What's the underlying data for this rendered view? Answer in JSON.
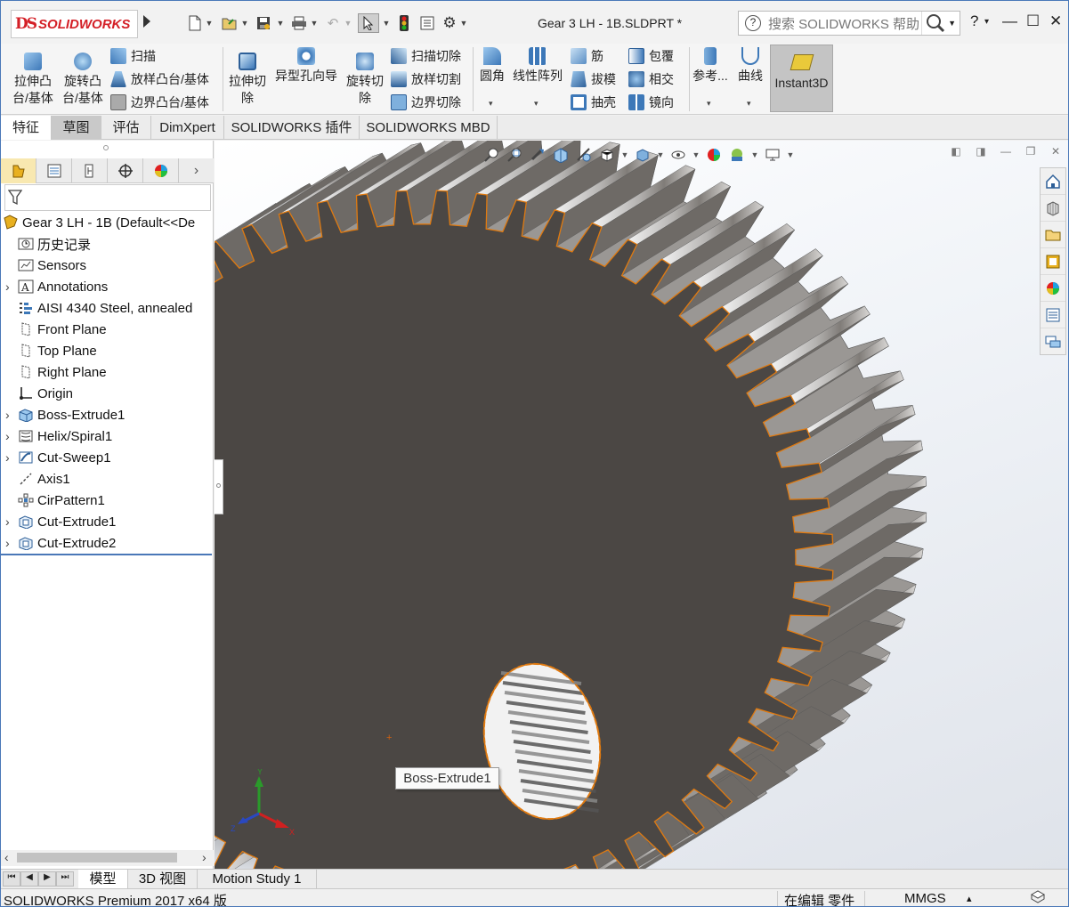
{
  "app": {
    "brand_mark": "DS",
    "brand_name": "SOLIDWORKS",
    "window_title": "Gear 3 LH - 1B.SLDPRT *"
  },
  "search": {
    "placeholder": "搜索 SOLIDWORKS 帮助",
    "help_char": "?"
  },
  "window_controls": {
    "help": "?",
    "help_dd": "▾",
    "minimize": "—",
    "maximize": "☐",
    "close": "✕"
  },
  "commands": {
    "extrude_boss": [
      "拉伸凸",
      "台/基体"
    ],
    "revolve_boss": [
      "旋转凸",
      "台/基体"
    ],
    "sweep": "扫描",
    "loft": "放样凸台/基体",
    "boundary": "边界凸台/基体",
    "extrude_cut": [
      "拉伸切",
      "除"
    ],
    "hole_wizard": "异型孔向导",
    "revolve_cut": [
      "旋转切",
      "除"
    ],
    "swept_cut": "扫描切除",
    "lofted_cut": "放样切割",
    "boundary_cut": "边界切除",
    "fillet": "圆角",
    "linear_pattern": "线性阵列",
    "rib": "筋",
    "draft": "拔模",
    "shell": "抽壳",
    "wrap": "包覆",
    "intersect": "相交",
    "mirror": "镜向",
    "reference": "参考...",
    "curves": "曲线",
    "instant3d": "Instant3D",
    "dd": "▾"
  },
  "tabs": [
    "特征",
    "草图",
    "评估",
    "DimXpert",
    "SOLIDWORKS 插件",
    "SOLIDWORKS MBD"
  ],
  "tree": {
    "root": "Gear 3 LH - 1B  (Default<<De",
    "items": [
      {
        "label": "历史记录",
        "icon": "history-icon",
        "expandable": false
      },
      {
        "label": "Sensors",
        "icon": "sensors-icon",
        "expandable": false
      },
      {
        "label": "Annotations",
        "icon": "annotations-icon",
        "expandable": true
      },
      {
        "label": "AISI 4340 Steel, annealed",
        "icon": "material-icon",
        "expandable": false
      },
      {
        "label": "Front Plane",
        "icon": "plane-icon",
        "expandable": false
      },
      {
        "label": "Top Plane",
        "icon": "plane-icon",
        "expandable": false
      },
      {
        "label": "Right Plane",
        "icon": "plane-icon",
        "expandable": false
      },
      {
        "label": "Origin",
        "icon": "origin-icon",
        "expandable": false
      },
      {
        "label": "Boss-Extrude1",
        "icon": "extrude-icon",
        "expandable": true
      },
      {
        "label": "Helix/Spiral1",
        "icon": "helix-icon",
        "expandable": true
      },
      {
        "label": "Cut-Sweep1",
        "icon": "cut-sweep-icon",
        "expandable": true
      },
      {
        "label": "Axis1",
        "icon": "axis-icon",
        "expandable": false
      },
      {
        "label": "CirPattern1",
        "icon": "cirpattern-icon",
        "expandable": false
      },
      {
        "label": "Cut-Extrude1",
        "icon": "cut-extrude-icon",
        "expandable": true
      },
      {
        "label": "Cut-Extrude2",
        "icon": "cut-extrude-icon",
        "expandable": true
      }
    ]
  },
  "viewport": {
    "tooltip": "Boss-Extrude1",
    "triad": {
      "x": "X",
      "y": "Y",
      "z": "Z"
    },
    "origin_symbol": "+"
  },
  "bottom_tabs": [
    "模型",
    "3D 视图",
    "Motion Study 1"
  ],
  "status": {
    "product": "SOLIDWORKS Premium 2017 x64 版",
    "mode": "在编辑 零件",
    "units": "MMGS",
    "units_dd": "▴"
  },
  "colors": {
    "accent": "#4a78b8",
    "brand": "#d42027",
    "gear_face": "#4b4744",
    "edge": "#e07a10"
  }
}
